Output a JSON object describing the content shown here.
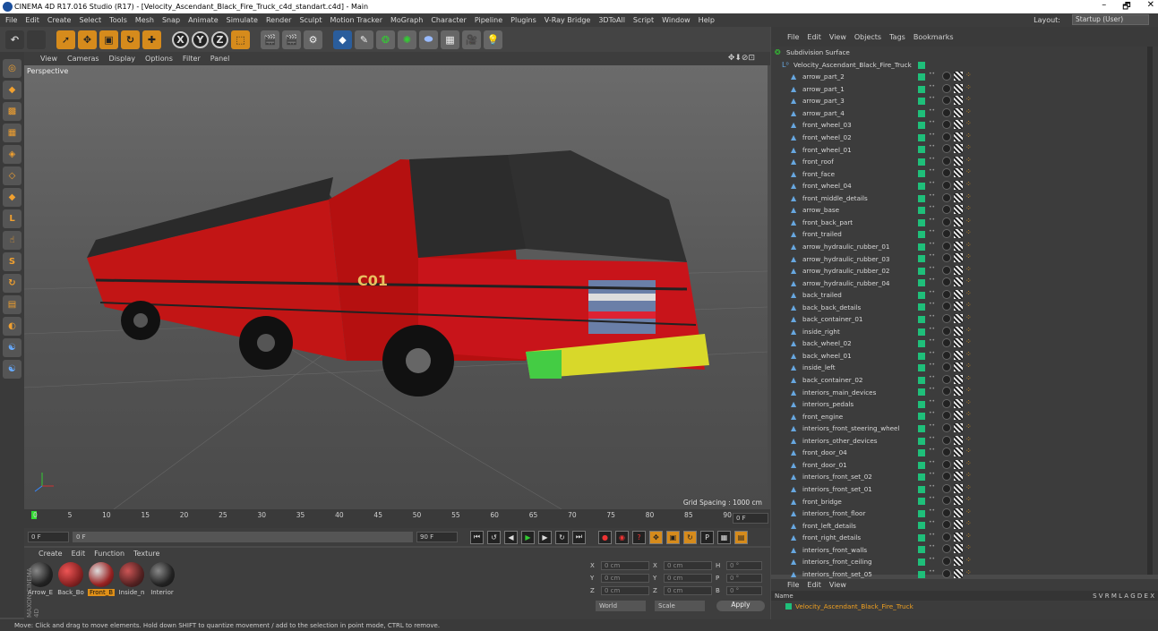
{
  "window": {
    "title": "CINEMA 4D R17.016 Studio (R17) - [Velocity_Ascendant_Black_Fire_Truck_c4d_standart.c4d] - Main",
    "min": "–",
    "max": "🗗",
    "close": "✕"
  },
  "menu": [
    "File",
    "Edit",
    "Create",
    "Select",
    "Tools",
    "Mesh",
    "Snap",
    "Animate",
    "Simulate",
    "Render",
    "Sculpt",
    "Motion Tracker",
    "MoGraph",
    "Character",
    "Pipeline",
    "Plugins",
    "V-Ray Bridge",
    "3DToAll",
    "Script",
    "Window",
    "Help"
  ],
  "layout": {
    "label": "Layout:",
    "value": "Startup (User)"
  },
  "toolbar": {
    "undo": "↶",
    "move": "✥",
    "scale": "▣",
    "rotate": "↻",
    "select": "➚",
    "x": "X",
    "y": "Y",
    "z": "Z"
  },
  "viewport": {
    "menu": [
      "View",
      "Cameras",
      "Display",
      "Options",
      "Filter",
      "Panel"
    ],
    "label": "Perspective",
    "grid_spacing": "Grid Spacing : 1000 cm",
    "nav_icons": "✥⬇⊘⊡"
  },
  "timeline": {
    "ticks": [
      "0",
      "5",
      "10",
      "15",
      "20",
      "25",
      "30",
      "35",
      "40",
      "45",
      "50",
      "55",
      "60",
      "65",
      "70",
      "75",
      "80",
      "85",
      "90"
    ],
    "end_field": "0 F",
    "start": "0 F",
    "current": "0 F",
    "end": "90 F",
    "max": "90 F"
  },
  "material_manager": {
    "menu": [
      "Create",
      "Edit",
      "Function",
      "Texture"
    ],
    "materials": [
      {
        "label": "Arrow_E"
      },
      {
        "label": "Back_Bo"
      },
      {
        "label": "Front_B",
        "active": true
      },
      {
        "label": "Inside_n"
      },
      {
        "label": "Interior"
      }
    ]
  },
  "coordinates": {
    "rows": [
      {
        "a": "X",
        "av": "0 cm",
        "b": "X",
        "bv": "0 cm",
        "c": "H",
        "cv": "0 °"
      },
      {
        "a": "Y",
        "av": "0 cm",
        "b": "Y",
        "bv": "0 cm",
        "c": "P",
        "cv": "0 °"
      },
      {
        "a": "Z",
        "av": "0 cm",
        "b": "Z",
        "bv": "0 cm",
        "c": "B",
        "cv": "0 °"
      }
    ],
    "world": "World",
    "scale": "Scale",
    "apply": "Apply"
  },
  "object_manager": {
    "menu": [
      "File",
      "Edit",
      "View",
      "Objects",
      "Tags",
      "Bookmarks"
    ],
    "root": "Subdivision Surface",
    "parent": "Velocity_Ascendant_Black_Fire_Truck",
    "children": [
      "arrow_part_2",
      "arrow_part_1",
      "arrow_part_3",
      "arrow_part_4",
      "front_wheel_03",
      "front_wheel_02",
      "front_wheel_01",
      "front_roof",
      "front_face",
      "front_wheel_04",
      "front_middle_details",
      "arrow_base",
      "front_back_part",
      "front_trailed",
      "arrow_hydraulic_rubber_01",
      "arrow_hydraulic_rubber_03",
      "arrow_hydraulic_rubber_02",
      "arrow_hydraulic_rubber_04",
      "back_trailed",
      "back_back_details",
      "back_container_01",
      "inside_right",
      "back_wheel_02",
      "back_wheel_01",
      "inside_left",
      "back_container_02",
      "interiors_main_devices",
      "interiors_pedals",
      "front_engine",
      "interiors_front_steering_wheel",
      "interiors_other_devices",
      "front_door_04",
      "front_door_01",
      "interiors_front_set_02",
      "interiors_front_set_01",
      "front_bridge",
      "interiors_front_floor",
      "front_left_details",
      "front_right_details",
      "interiors_front_walls",
      "interiors_front_ceiling",
      "interiors_front_set_05"
    ]
  },
  "attribute_manager": {
    "menu": [
      "File",
      "Edit",
      "View"
    ],
    "header_name": "Name",
    "header_cols": "S V R M L A G D E X",
    "row": "Velocity_Ascendant_Black_Fire_Truck"
  },
  "status": "Move: Click and drag to move elements. Hold down SHIFT to quantize movement / add to the selection in point mode, CTRL to remove."
}
